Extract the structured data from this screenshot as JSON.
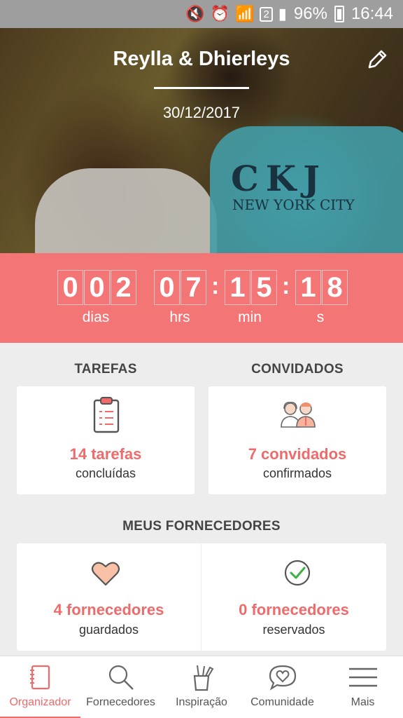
{
  "status_bar": {
    "battery": "96%",
    "time": "16:44",
    "sim": "2"
  },
  "header": {
    "couple_name": "Reylla & Dhierleys",
    "wedding_date": "30/12/2017",
    "photo_text": {
      "big": "CKJ",
      "small": "NEW YORK CITY"
    }
  },
  "countdown": {
    "days": [
      "0",
      "0",
      "2"
    ],
    "hours": [
      "0",
      "7"
    ],
    "minutes": [
      "1",
      "5"
    ],
    "seconds": [
      "1",
      "8"
    ],
    "labels": {
      "days": "dias",
      "hours": "hrs",
      "minutes": "min",
      "seconds": "s"
    }
  },
  "tasks": {
    "title": "TAREFAS",
    "count": "14 tarefas",
    "sub": "concluídas"
  },
  "guests": {
    "title": "CONVIDADOS",
    "count": "7 convidados",
    "sub": "confirmados"
  },
  "vendors": {
    "title": "MEUS FORNECEDORES",
    "saved": {
      "count": "4 fornecedores",
      "sub": "guardados"
    },
    "booked": {
      "count": "0 fornecedores",
      "sub": "reservados"
    }
  },
  "nav": [
    {
      "label": "Organizador",
      "icon": "notebook-icon",
      "active": true
    },
    {
      "label": "Fornecedores",
      "icon": "search-icon",
      "active": false
    },
    {
      "label": "Inspiração",
      "icon": "inspiration-cup-icon",
      "active": false
    },
    {
      "label": "Comunidade",
      "icon": "heart-chat-icon",
      "active": false
    },
    {
      "label": "Mais",
      "icon": "menu-icon",
      "active": false
    }
  ],
  "colors": {
    "accent": "#f47575",
    "text_accent": "#ef6b6b",
    "background": "#ededed"
  }
}
